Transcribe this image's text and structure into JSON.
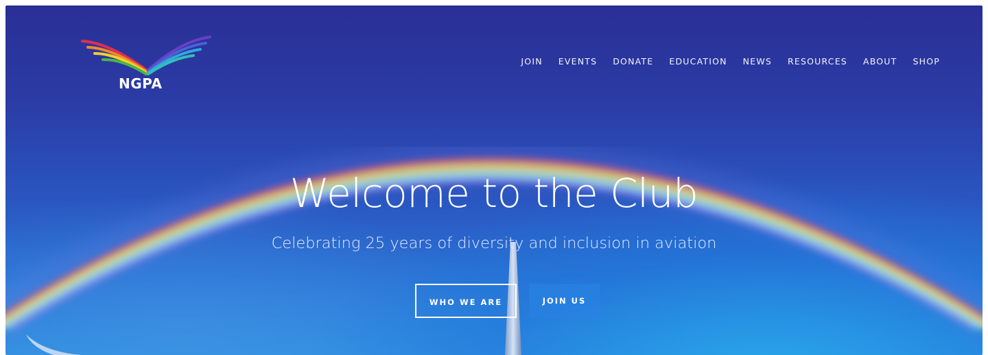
{
  "logo": {
    "text": "NGPA"
  },
  "nav": {
    "items": [
      {
        "label": "JOIN"
      },
      {
        "label": "EVENTS"
      },
      {
        "label": "DONATE"
      },
      {
        "label": "EDUCATION"
      },
      {
        "label": "NEWS"
      },
      {
        "label": "RESOURCES"
      },
      {
        "label": "ABOUT"
      },
      {
        "label": "SHOP"
      }
    ]
  },
  "hero": {
    "headline": "Welcome to the Club",
    "subheadline": "Celebrating 25 years of diversity and inclusion in aviation",
    "primary_button": "WHO WE ARE",
    "secondary_button": "JOIN US"
  },
  "colors": {
    "sky_top": "#2a2f95",
    "sky_bottom": "#2f8fe0",
    "text": "#ffffff"
  }
}
